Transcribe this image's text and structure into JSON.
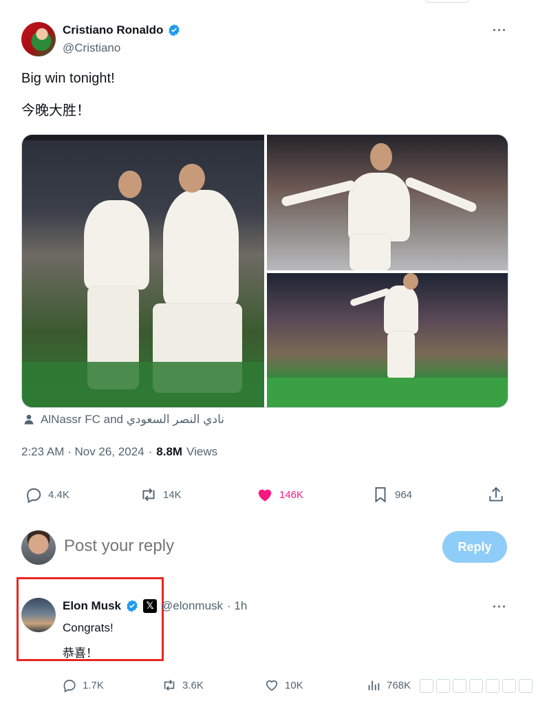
{
  "post": {
    "author": {
      "display_name": "Cristiano Ronaldo",
      "handle": "@Cristiano"
    },
    "text_lines": [
      "Big win tonight!",
      "今晚大胜！"
    ],
    "tagged": "AlNassr FC and نادي النصر السعودي",
    "timestamp": "2:23 AM · Nov 26, 2024",
    "views_count": "8.8M",
    "views_label": "Views",
    "stats": {
      "replies": "4.4K",
      "reposts": "14K",
      "likes": "146K",
      "bookmarks": "964"
    }
  },
  "composer": {
    "placeholder": "Post your reply",
    "button_label": "Reply"
  },
  "reply": {
    "author": {
      "display_name": "Elon Musk",
      "handle": "@elonmusk",
      "time": "· 1h",
      "affiliate_badge": "𝕏"
    },
    "text_lines": [
      "Congrats!",
      "恭喜！"
    ],
    "stats": {
      "replies": "1.7K",
      "reposts": "3.6K",
      "likes": "10K",
      "views": "768K"
    }
  },
  "colors": {
    "accent": "#1d9bf0",
    "like": "#f91880",
    "highlight_box": "#e8261f",
    "reply_button": "#8ecdf8"
  },
  "icons": [
    "verified-badge-icon",
    "more-icon",
    "person-icon",
    "reply-icon",
    "repost-icon",
    "heart-icon",
    "bookmark-icon",
    "share-icon",
    "analytics-icon"
  ]
}
